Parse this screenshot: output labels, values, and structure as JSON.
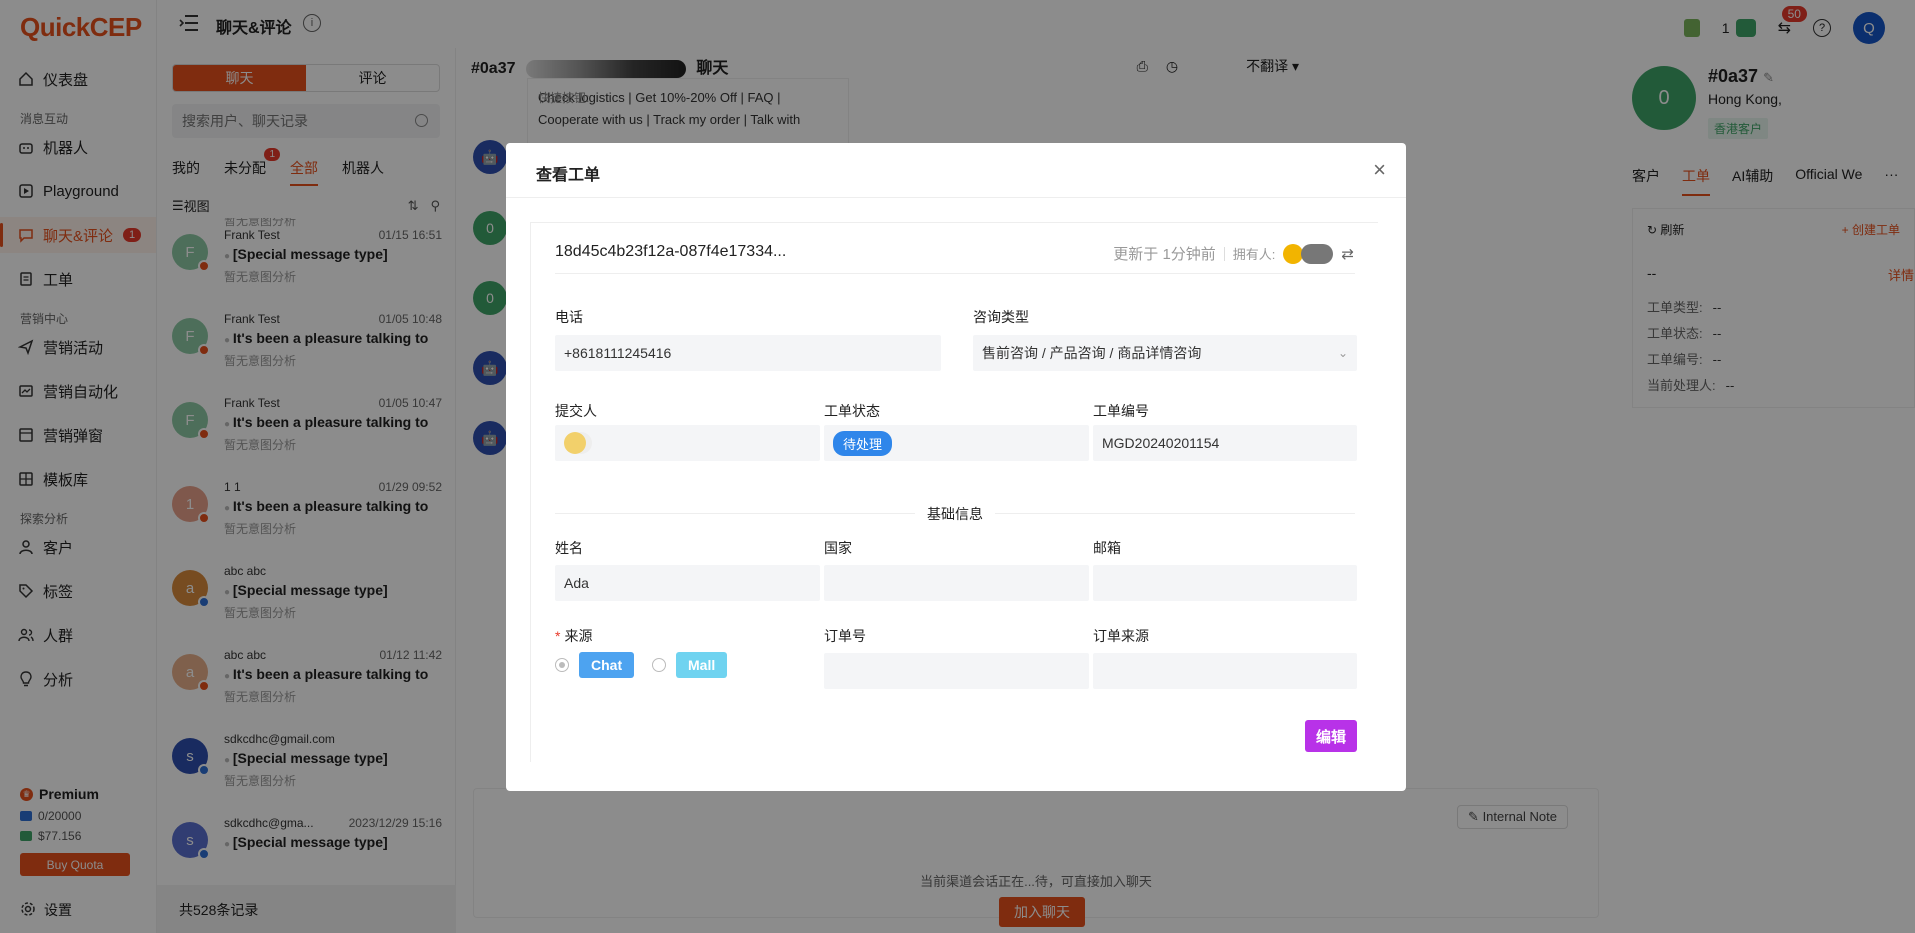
{
  "app": {
    "logo": "QuickCEP",
    "page_title": "聊天&评论"
  },
  "sidebar": {
    "groups": {
      "msg": "消息互动",
      "marketing": "营销中心",
      "explore": "探索分析"
    },
    "items": [
      {
        "label": "仪表盘",
        "icon": "home-icon"
      },
      {
        "label": "机器人",
        "icon": "robot-icon"
      },
      {
        "label": "Playground",
        "icon": "playground-icon"
      },
      {
        "label": "聊天&评论",
        "icon": "chat-icon",
        "badge": "1"
      },
      {
        "label": "工单",
        "icon": "ticket-icon"
      },
      {
        "label": "营销活动",
        "icon": "send-icon"
      },
      {
        "label": "营销自动化",
        "icon": "automation-icon"
      },
      {
        "label": "营销弹窗",
        "icon": "popup-icon"
      },
      {
        "label": "模板库",
        "icon": "template-icon"
      },
      {
        "label": "客户",
        "icon": "user-icon"
      },
      {
        "label": "标签",
        "icon": "tag-icon"
      },
      {
        "label": "人群",
        "icon": "group-icon"
      },
      {
        "label": "分析",
        "icon": "bulb-icon"
      }
    ],
    "plan": "Premium",
    "email_quota": "0/20000",
    "balance": "$77.156",
    "buy_label": "Buy Quota",
    "settings_label": "设置"
  },
  "topbar": {
    "num": "1",
    "swap_badge": "50",
    "avatar": "Q"
  },
  "convlist": {
    "seg": [
      "聊天",
      "评论"
    ],
    "search_placeholder": "搜索用户、聊天记录",
    "tabs": [
      "我的",
      "未分配",
      "全部",
      "机器人"
    ],
    "unassigned_badge": "1",
    "view_label": "视图",
    "partial_top": "暂无意图分析",
    "items": [
      {
        "name": "Frank Test",
        "time": "01/15 16:51",
        "msg": "[Special message type]",
        "sub": "暂无意图分析",
        "avatar": "F",
        "color": "#8cc9a4",
        "ch": "#e8501c"
      },
      {
        "name": "Frank Test",
        "time": "01/05 10:48",
        "msg": "It's been a pleasure talking to",
        "sub": "暂无意图分析",
        "avatar": "F",
        "color": "#8cc9a4",
        "ch": "#e8501c"
      },
      {
        "name": "Frank Test",
        "time": "01/05 10:47",
        "msg": "It's been a pleasure talking to",
        "sub": "暂无意图分析",
        "avatar": "F",
        "color": "#8cc9a4",
        "ch": "#e8501c"
      },
      {
        "name": "1 1",
        "time": "01/29 09:52",
        "msg": "It's been a pleasure talking to",
        "sub": "暂无意图分析",
        "avatar": "1",
        "color": "#e8a08a",
        "ch": "#e8501c"
      },
      {
        "name": "abc abc",
        "time": "",
        "msg": "[Special message type]",
        "sub": "暂无意图分析",
        "avatar": "a",
        "color": "#d98a3c",
        "ch": "#2f6fd6"
      },
      {
        "name": "abc abc",
        "time": "01/12 11:42",
        "msg": "It's been a pleasure talking to",
        "sub": "暂无意图分析",
        "avatar": "a",
        "color": "#e8b08a",
        "ch": "#e8501c"
      },
      {
        "name": "sdkcdhc@gmail.com",
        "time": "",
        "msg": "[Special message type]",
        "sub": "暂无意图分析",
        "avatar": "s",
        "color": "#2f4fb0",
        "ch": "#2f6fd6"
      },
      {
        "name": "sdkcdhc@gma...",
        "time": "2023/12/29 15:16",
        "msg": "[Special message type]",
        "sub": "",
        "avatar": "s",
        "color": "#5a6fd0",
        "ch": "#2f6fd6"
      }
    ],
    "total": "共528条记录"
  },
  "chat": {
    "title_prefix": "#0a37",
    "title_suffix": "聊天",
    "translate": "不翻译",
    "quick_label": "快捷按钮:",
    "quick_text": "Check logistics | Get 10%-20% Off | FAQ | Cooperate with us | Track my order | Talk with",
    "note_label": "Internal Note",
    "join_text": "当前渠道会话正在...待，可直接加入聊天",
    "join_label": "加入聊天",
    "avatar_zero": "0"
  },
  "rpanel": {
    "avatar": "0",
    "id": "#0a37",
    "location": "Hong Kong,",
    "tag": "香港客户",
    "tabs": [
      "客户",
      "工单",
      "AI辅助",
      "Official We"
    ],
    "refresh": "刷新",
    "create": "+ 创建工单",
    "dash": "--",
    "detail": "详情",
    "fields": [
      {
        "label": "工单类型:",
        "value": "--"
      },
      {
        "label": "工单状态:",
        "value": "--"
      },
      {
        "label": "工单编号:",
        "value": "--"
      },
      {
        "label": "当前处理人:",
        "value": "--"
      }
    ]
  },
  "modal": {
    "title": "查看工单",
    "ticket_id": "18d45c4b23f12a-087f4e17334...",
    "updated": "更新于 1分钟前",
    "owner_label": "拥有人:",
    "phone_label": "电话",
    "phone_value": "+8618111245416",
    "type_label": "咨询类型",
    "type_value": "售前咨询 / 产品咨询 / 商品详情咨询",
    "submitter_label": "提交人",
    "status_label": "工单状态",
    "status_value": "待处理",
    "number_label": "工单编号",
    "number_value": "MGD20240201154",
    "section_title": "基础信息",
    "name_label": "姓名",
    "name_value": "Ada",
    "country_label": "国家",
    "email_label": "邮箱",
    "source_label": "来源",
    "source_options": [
      {
        "label": "Chat",
        "color": "#4da3f0"
      },
      {
        "label": "Mall",
        "color": "#6fd3f0"
      }
    ],
    "order_label": "订单号",
    "order_source_label": "订单来源",
    "edit_label": "编辑"
  }
}
